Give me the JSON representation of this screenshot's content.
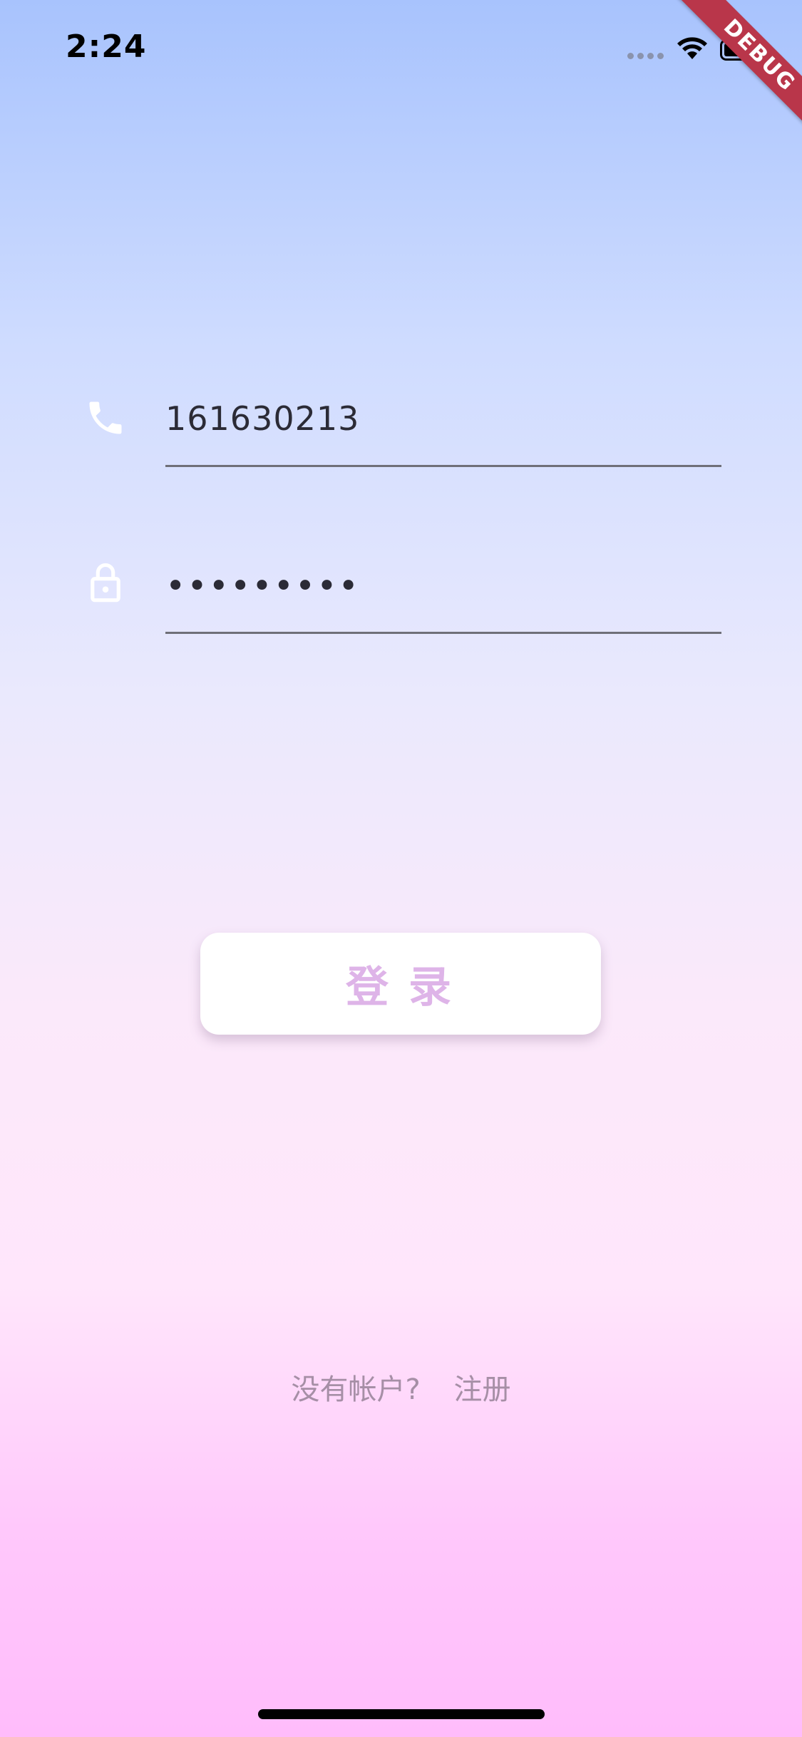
{
  "status_bar": {
    "time": "2:24"
  },
  "debug_banner": {
    "label": "DEBUG",
    "color": "#b9364a"
  },
  "phone_field": {
    "icon": "phone-icon",
    "value": "161630213"
  },
  "password_field": {
    "icon": "lock-icon",
    "value": "•••••••••"
  },
  "login_button": {
    "label": "登录",
    "text_color": "#deb4e8"
  },
  "register": {
    "prompt": "没有帐户?",
    "link": "注册"
  }
}
